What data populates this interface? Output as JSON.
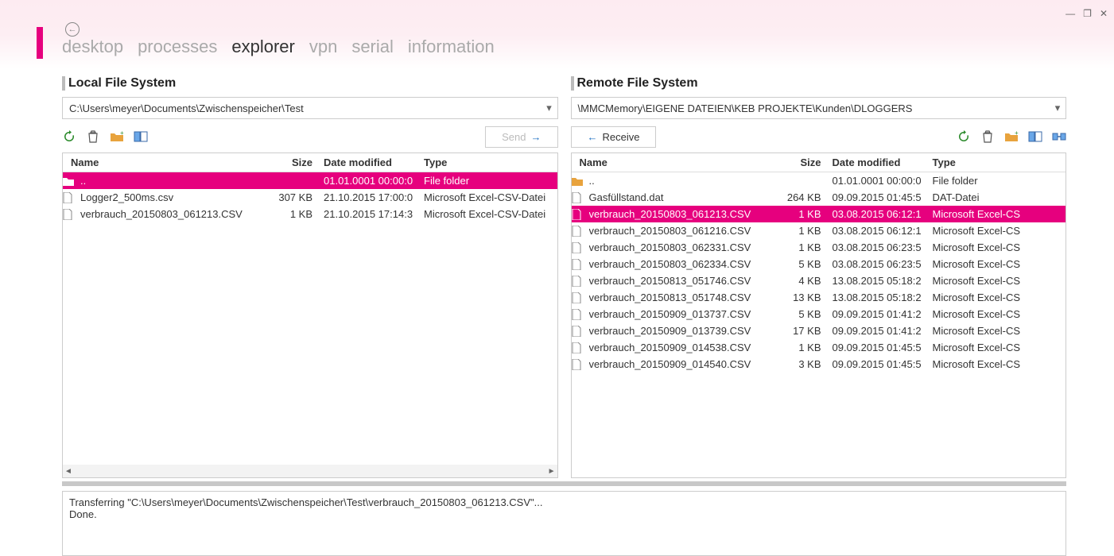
{
  "window_controls": {
    "minimize": "—",
    "restore": "❐",
    "close": "✕"
  },
  "nav": {
    "tabs": [
      "desktop",
      "processes",
      "explorer",
      "vpn",
      "serial",
      "information"
    ],
    "active_index": 2
  },
  "local": {
    "title": "Local File System",
    "path": "C:\\Users\\meyer\\Documents\\Zwischenspeicher\\Test",
    "send_label": "Send",
    "send_enabled": false,
    "headers": {
      "name": "Name",
      "size": "Size",
      "date": "Date modified",
      "type": "Type"
    },
    "rows": [
      {
        "icon": "folder",
        "name": "..",
        "size": "",
        "date": "01.01.0001 00:00:0",
        "type": "File folder",
        "selected": true
      },
      {
        "icon": "file",
        "name": "Logger2_500ms.csv",
        "size": "307 KB",
        "date": "21.10.2015 17:00:0",
        "type": "Microsoft Excel-CSV-Datei",
        "selected": false
      },
      {
        "icon": "file",
        "name": "verbrauch_20150803_061213.CSV",
        "size": "1 KB",
        "date": "21.10.2015 17:14:3",
        "type": "Microsoft Excel-CSV-Datei",
        "selected": false
      }
    ]
  },
  "remote": {
    "title": "Remote File System",
    "path": "\\MMCMemory\\EIGENE DATEIEN\\KEB PROJEKTE\\Kunden\\DLOGGERS",
    "receive_label": "Receive",
    "headers": {
      "name": "Name",
      "size": "Size",
      "date": "Date modified",
      "type": "Type"
    },
    "rows": [
      {
        "icon": "folder",
        "name": "..",
        "size": "",
        "date": "01.01.0001 00:00:0",
        "type": "File folder",
        "selected": false
      },
      {
        "icon": "file",
        "name": "Gasfüllstand.dat",
        "size": "264 KB",
        "date": "09.09.2015 01:45:5",
        "type": "DAT-Datei",
        "selected": false
      },
      {
        "icon": "file",
        "name": "verbrauch_20150803_061213.CSV",
        "size": "1 KB",
        "date": "03.08.2015 06:12:1",
        "type": "Microsoft Excel-CS",
        "selected": true
      },
      {
        "icon": "file",
        "name": "verbrauch_20150803_061216.CSV",
        "size": "1 KB",
        "date": "03.08.2015 06:12:1",
        "type": "Microsoft Excel-CS",
        "selected": false
      },
      {
        "icon": "file",
        "name": "verbrauch_20150803_062331.CSV",
        "size": "1 KB",
        "date": "03.08.2015 06:23:5",
        "type": "Microsoft Excel-CS",
        "selected": false
      },
      {
        "icon": "file",
        "name": "verbrauch_20150803_062334.CSV",
        "size": "5 KB",
        "date": "03.08.2015 06:23:5",
        "type": "Microsoft Excel-CS",
        "selected": false
      },
      {
        "icon": "file",
        "name": "verbrauch_20150813_051746.CSV",
        "size": "4 KB",
        "date": "13.08.2015 05:18:2",
        "type": "Microsoft Excel-CS",
        "selected": false
      },
      {
        "icon": "file",
        "name": "verbrauch_20150813_051748.CSV",
        "size": "13 KB",
        "date": "13.08.2015 05:18:2",
        "type": "Microsoft Excel-CS",
        "selected": false
      },
      {
        "icon": "file",
        "name": "verbrauch_20150909_013737.CSV",
        "size": "5 KB",
        "date": "09.09.2015 01:41:2",
        "type": "Microsoft Excel-CS",
        "selected": false
      },
      {
        "icon": "file",
        "name": "verbrauch_20150909_013739.CSV",
        "size": "17 KB",
        "date": "09.09.2015 01:41:2",
        "type": "Microsoft Excel-CS",
        "selected": false
      },
      {
        "icon": "file",
        "name": "verbrauch_20150909_014538.CSV",
        "size": "1 KB",
        "date": "09.09.2015 01:45:5",
        "type": "Microsoft Excel-CS",
        "selected": false
      },
      {
        "icon": "file",
        "name": "verbrauch_20150909_014540.CSV",
        "size": "3 KB",
        "date": "09.09.2015 01:45:5",
        "type": "Microsoft Excel-CS",
        "selected": false
      }
    ]
  },
  "log": {
    "lines": [
      "Transferring \"C:\\Users\\meyer\\Documents\\Zwischenspeicher\\Test\\verbrauch_20150803_061213.CSV\"...",
      "Done."
    ]
  }
}
